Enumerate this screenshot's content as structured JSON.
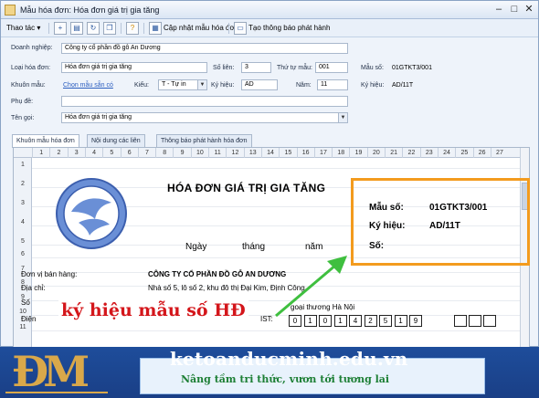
{
  "window": {
    "title": "Mẫu hóa đơn: Hóa đơn giá trị gia tăng"
  },
  "toolbar": {
    "menu_label": "Thao tác ▾",
    "update_label": "Cập nhật mẫu hóa đơn",
    "notice_label": "Tạo thông báo phát hành"
  },
  "form": {
    "company_label": "Doanh nghiệp:",
    "company_value": "Công ty cổ phần đồ gỗ An Dương",
    "invoice_type_label": "Loại hóa đơn:",
    "invoice_type_value": "Hóa đơn giá trị gia tăng",
    "copies_label": "Số liên:",
    "copies_value": "3",
    "order_label": "Thứ tự mẫu:",
    "order_value": "001",
    "form_no_label": "Mẫu số:",
    "form_no_value": "01GTKT3/001",
    "template_label": "Khuôn mẫu:",
    "template_link": "Chọn mẫu sẵn có",
    "style_label": "Kiểu:",
    "style_value": "T - Tự in",
    "symbol_label": "Ký hiệu:",
    "symbol_value": "AD",
    "year_label": "Năm:",
    "year_value": "11",
    "serial_label": "Ký hiệu:",
    "serial_value": "AD/11T",
    "subtitle_label": "Phụ đề:",
    "subtitle_value": "",
    "name_label": "Tên gọi:",
    "name_value": "Hóa đơn giá trị gia tăng"
  },
  "tabs": [
    "Khuôn mẫu hóa đơn",
    "Nội dung các liên",
    "Thông báo phát hành hóa đơn"
  ],
  "sheet": {
    "columns": [
      "1",
      "2",
      "3",
      "4",
      "5",
      "6",
      "7",
      "8",
      "9",
      "10",
      "11",
      "12",
      "13",
      "14",
      "15",
      "16",
      "17",
      "18",
      "19",
      "20",
      "21",
      "22",
      "23",
      "24",
      "25",
      "26",
      "27"
    ],
    "rows": [
      "1",
      "2",
      "3",
      "4",
      "5",
      "6",
      "7",
      "8",
      "9",
      "10",
      "11"
    ]
  },
  "invoice": {
    "title": "HÓA ĐƠN GIÁ TRỊ GIA TĂNG",
    "day": "Ngày",
    "month": "tháng",
    "year": "năm",
    "form_no_label": "Mẫu số:",
    "form_no_value": "01GTKT3/001",
    "serial_label": "Ký hiệu:",
    "serial_value": "AD/11T",
    "number_label": "Số:",
    "seller_label": "Đơn vị bán hàng:",
    "seller_value": "CÔNG TY CỔ PHẦN ĐỒ GỖ AN DƯƠNG",
    "address_label": "Địa chỉ:",
    "address_value": "Nhà số 5, lô số 2, khu đô thị Đại Kim, Định Công",
    "phone_label": "Số",
    "bank_tail": "goại thương Hà Nội",
    "phone_short": "Điện",
    "tax_label": "IST:",
    "tax_digits": [
      "0",
      "1",
      "0",
      "1",
      "4",
      "2",
      "5",
      "1",
      "9"
    ]
  },
  "overlay": {
    "caption": "ký hiệu mẫu số HĐ"
  },
  "banner": {
    "logo": "ĐM",
    "site": "ketoanducminh.edu.vn",
    "slogan": "Nâng tầm tri thức, vươn tới tương lai"
  },
  "colors": {
    "highlight": "#f39b1e",
    "caption": "#d4161b",
    "banner": "#1e4d9b",
    "slogan": "#1d7f35",
    "arrow": "#3fbf3f"
  }
}
